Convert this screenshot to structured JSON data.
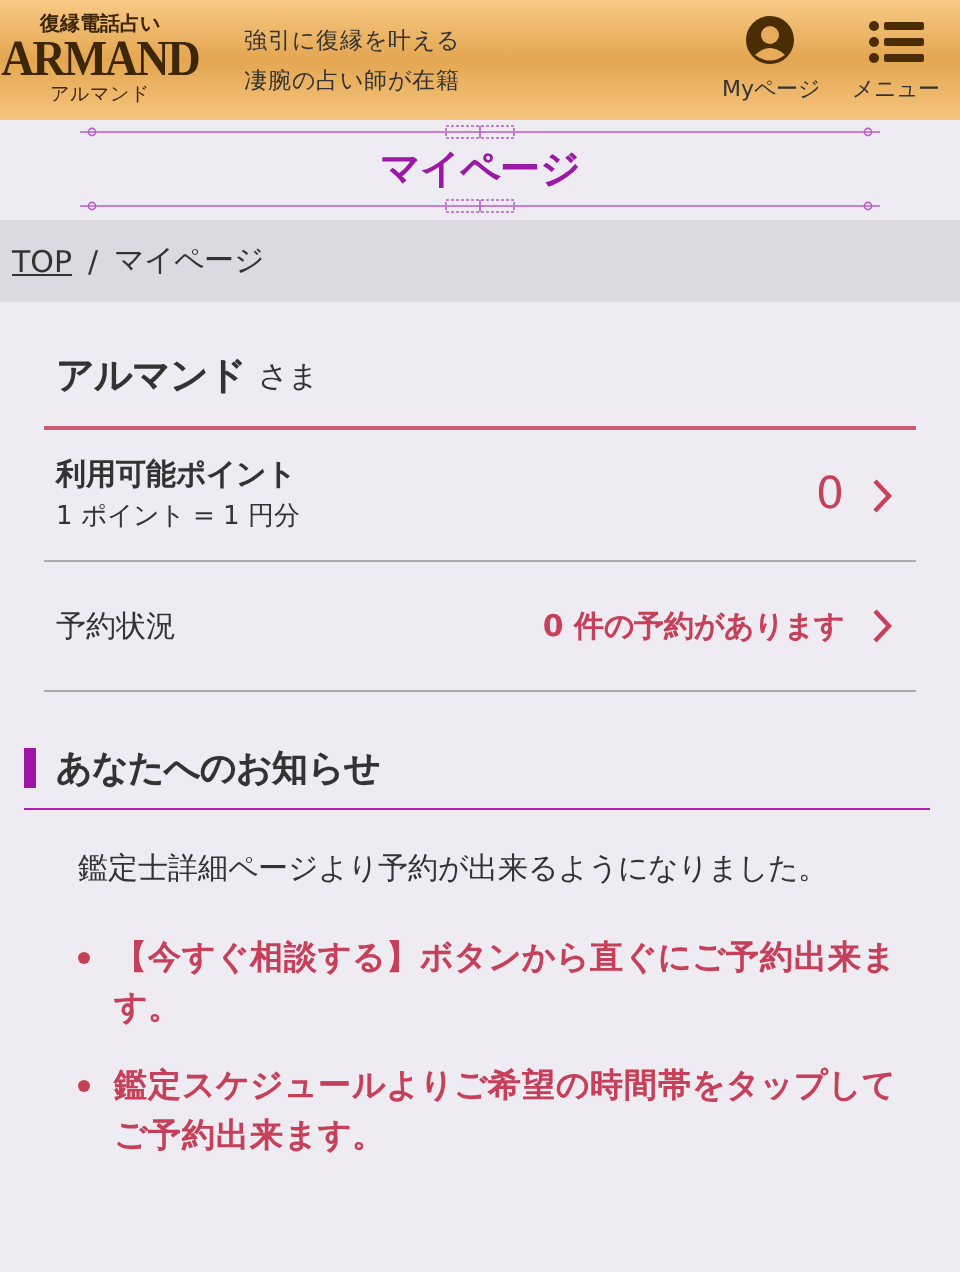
{
  "header": {
    "logo": {
      "top": "復縁電話占い",
      "main": "ARMAND",
      "bottom": "アルマンド"
    },
    "tagline": [
      "強引に復縁を叶える",
      "凄腕の占い師が在籍"
    ],
    "nav": [
      {
        "kind": "user",
        "label": "Myページ"
      },
      {
        "kind": "menu",
        "label": "メニュー"
      }
    ]
  },
  "page_title": "マイページ",
  "breadcrumb_separator": "/",
  "breadcrumb": [
    {
      "label": "TOP",
      "link": true
    },
    {
      "label": "マイページ",
      "link": false
    }
  ],
  "account": {
    "name": "アルマンド",
    "honorific": "さま",
    "rows": [
      {
        "kind": "points",
        "label": "利用可能ポイント",
        "note": "1 ポイント = 1 円分",
        "value": "0"
      },
      {
        "kind": "plain",
        "label": "予約状況",
        "value": "0 件の予約があります"
      }
    ]
  },
  "notices": {
    "heading": "あなたへのお知らせ",
    "intro": "鑑定士詳細ページより予約が出来るようになりました。",
    "items": [
      "【今すぐ相談する】ボタンから直ぐにご予約出来ます。",
      "鑑定スケジュールよりご希望の時間帯をタップしてご予約出来ます。"
    ]
  }
}
